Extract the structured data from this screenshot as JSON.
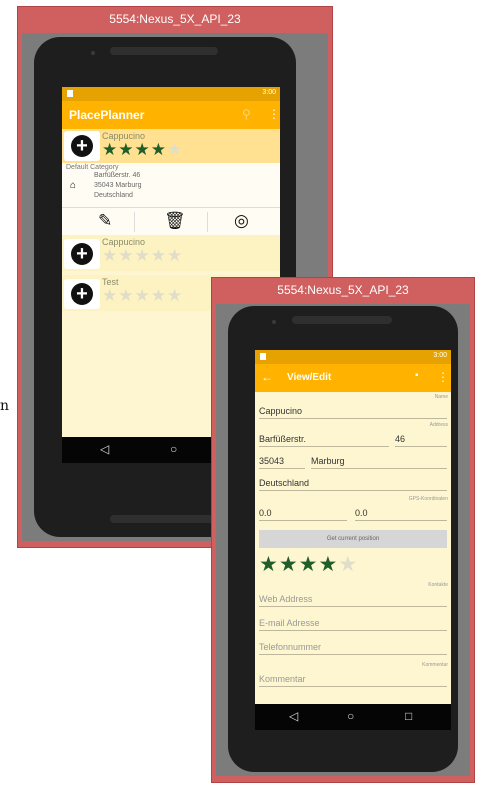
{
  "stray_char": "n",
  "emulator": {
    "title": "5554:Nexus_5X_API_23"
  },
  "status": {
    "time": "3:00"
  },
  "list_screen": {
    "app_title": "PlacePlanner",
    "search_icon": "search-icon",
    "more_icon": "more-vert-icon",
    "items": [
      {
        "name": "Cappucino",
        "rating": 4
      },
      {
        "name": "Cappucino",
        "rating": 0
      },
      {
        "name": "Test",
        "rating": 0
      }
    ],
    "detail": {
      "category": "Default Category",
      "street": "Barfüßerstr.",
      "number": "46",
      "zip": "35043",
      "city": "Marburg",
      "country": "Deutschland"
    },
    "actions": [
      "edit-icon",
      "delete-icon",
      "gps-target-icon"
    ],
    "nav": {
      "back": "◁",
      "home": "○"
    }
  },
  "edit_screen": {
    "title": "View/Edit",
    "labels": {
      "name": "Name",
      "address": "Address",
      "gps": "GPS-Koordinaten",
      "kontakte": "Kontakte",
      "kommentar": "Kommentar"
    },
    "name": "Cappucino",
    "street": "Barfüßerstr.",
    "number": "46",
    "zip": "35043",
    "city": "Marburg",
    "country": "Deutschland",
    "lat": "0.0",
    "lon": "0.0",
    "position_button": "Get current position",
    "rating": 4,
    "placeholders": {
      "web": "Web Address",
      "email": "E-mail Adresse",
      "phone": "Telefonnummer",
      "comment": "Kommentar"
    },
    "nav": {
      "back": "◁",
      "home": "○",
      "recent": "□"
    }
  },
  "colors": {
    "appbar": "#ffb300",
    "statusbar": "#e6a200",
    "star": "#1f5e2a",
    "background": "#fdf6d0",
    "emulator": "#d05f5f"
  }
}
